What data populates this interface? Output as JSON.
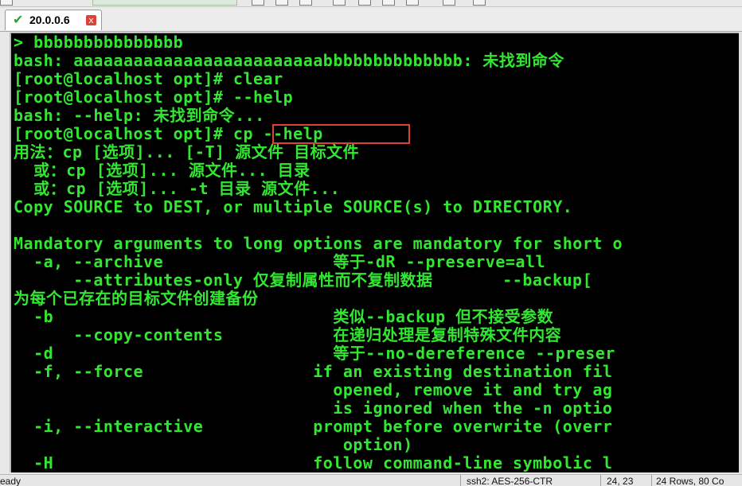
{
  "tab": {
    "label": "20.0.0.6",
    "status_icon": "check-icon",
    "close_glyph": "x"
  },
  "terminal": {
    "lines": [
      "> bbbbbbbbbbbbbbb",
      "bash: aaaaaaaaaaaaaaaaaaaaaaaaabbbbbbbbbbbbbb: 未找到命令",
      "[root@localhost opt]# clear",
      "[root@localhost opt]# --help",
      "bash: --help: 未找到命令...",
      "[root@localhost opt]# cp --help",
      "用法：cp [选项]... [-T] 源文件 目标文件",
      "  或：cp [选项]... 源文件... 目录",
      "  或：cp [选项]... -t 目录 源文件...",
      "Copy SOURCE to DEST, or multiple SOURCE(s) to DIRECTORY.",
      "",
      "Mandatory arguments to long options are mandatory for short o",
      "  -a, --archive                 等于-dR --preserve=all",
      "      --attributes-only 仅复制属性而不复制数据       --backup[",
      "为每个已存在的目标文件创建备份",
      "  -b                            类似--backup 但不接受参数",
      "      --copy-contents           在递归处理是复制特殊文件内容",
      "  -d                            等于--no-dereference --preser",
      "  -f, --force                 if an existing destination fil",
      "                                opened, remove it and try ag",
      "                                is ignored when the -n optio",
      "  -i, --interactive           prompt before overwrite (overr",
      "                                 option)",
      "  -H                          follow command-line symbolic l"
    ],
    "highlighted_command": "cp --help",
    "text_color": "#32e632",
    "background_color": "#000000",
    "highlight_color": "#e0403a"
  },
  "statusbar": {
    "ready": "eady",
    "cipher": "ssh2: AES-256-CTR",
    "cursor": "24, 23",
    "size": "24 Rows, 80 Co"
  }
}
